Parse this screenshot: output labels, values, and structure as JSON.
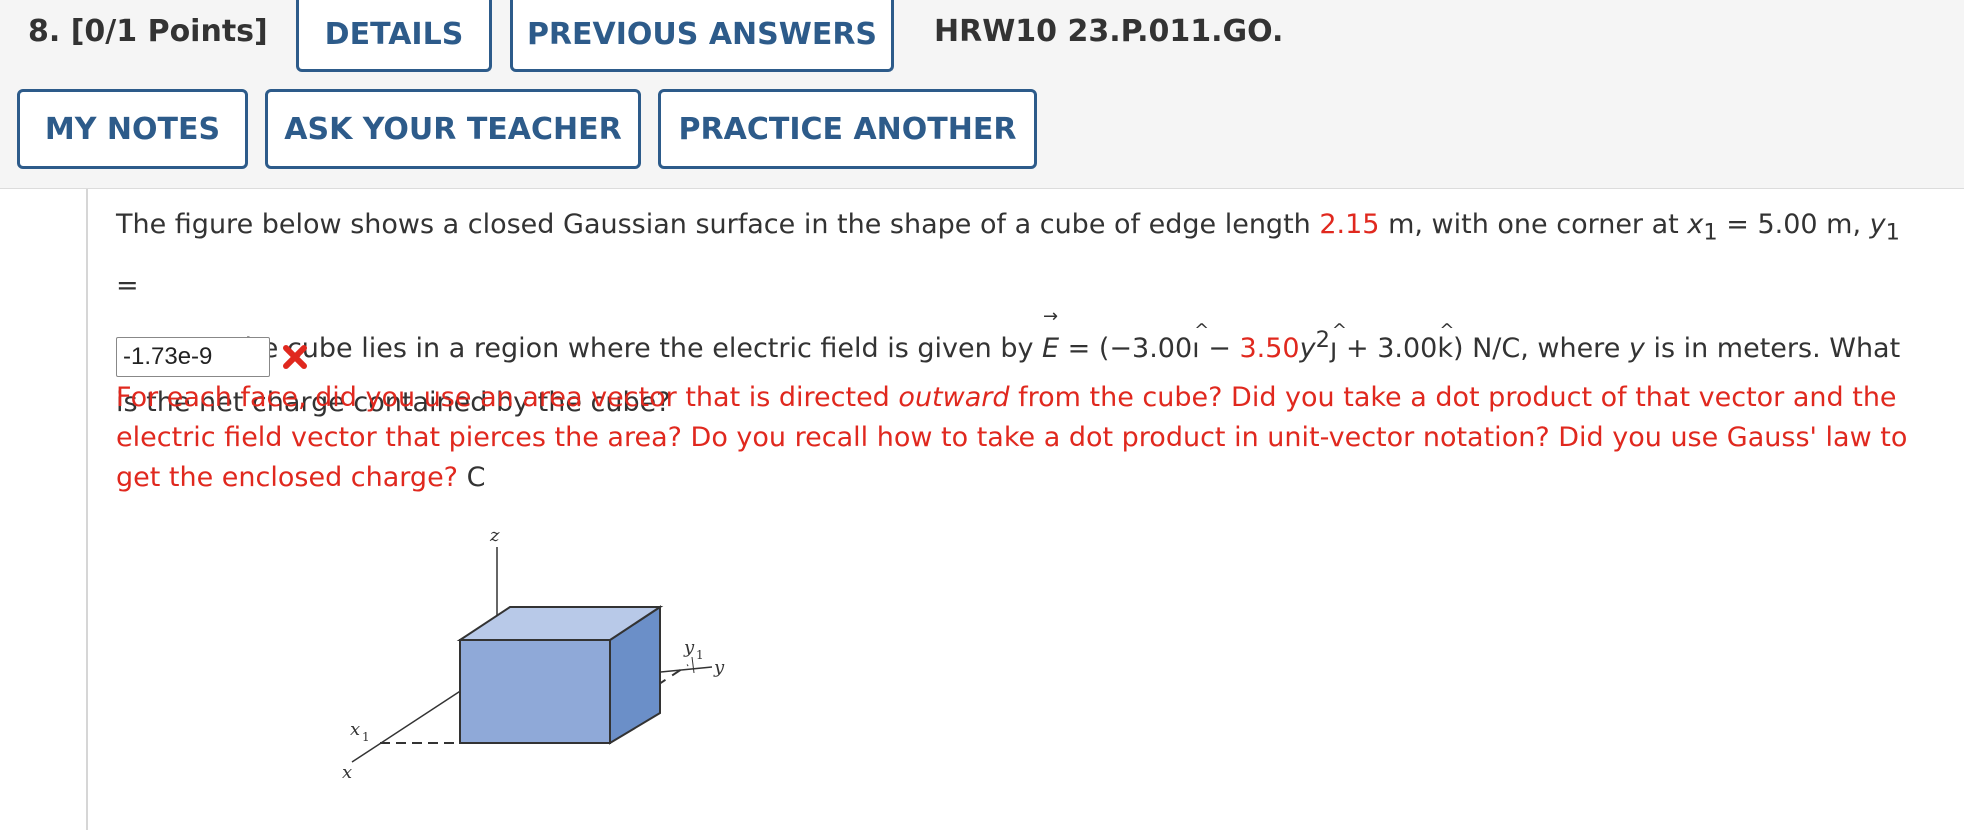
{
  "header": {
    "question_label": "8.  [0/1 Points]",
    "details_label": "DETAILS",
    "previous_answers_label": "PREVIOUS ANSWERS",
    "problem_code": "HRW10 23.P.011.GO.",
    "my_notes_label": "MY NOTES",
    "ask_teacher_label": "ASK YOUR TEACHER",
    "practice_label": "PRACTICE ANOTHER"
  },
  "question": {
    "t1": "The figure below shows a closed Gaussian surface in the shape of a cube of edge length ",
    "edge_length": "2.15",
    "t2": " m, with one corner at ",
    "x_var": "x",
    "sub1": "1",
    "t3": " = 5.00 m, ",
    "y_var": "y",
    "sub2": "1",
    "t4": " =",
    "t5": "4.00 m. The cube lies in a region where the electric field is given by ",
    "E_symbol": "E",
    "E_arrow": "→",
    "t6": " = (−3.00",
    "i_hat_letter": "ı",
    "hat_mark": "^",
    "t7": " − ",
    "coef_red": "3.50",
    "y_var2": "y",
    "exp2": "2",
    "j_hat_letter": "ȷ",
    "hat_mark2": "^",
    "t8": " + 3.00",
    "k_hat_letter": "k",
    "hat_mark3": "^",
    "t9": ") N/C, where ",
    "y_var3": "y",
    "t10": " is in meters. What is the net charge contained by the cube?"
  },
  "answer": {
    "value": "-1.73e-9",
    "status": "incorrect"
  },
  "feedback": {
    "f1": "For each face, did you use an area vector that is directed ",
    "f_em": "outward",
    "f2": " from the cube? Did you take a dot product of that vector and the electric field vector that pierces the area? Do you recall how to take a dot product in unit-vector notation? Did you use Gauss' law to get the enclosed charge? ",
    "unit": "C"
  },
  "figure": {
    "z_label": "z",
    "y1_label": "y",
    "y1_sub": "1",
    "y_label": "y",
    "x1_label": "x",
    "x1_sub": "1",
    "x_label": "x"
  },
  "colors": {
    "accent_blue": "#2d5b8a",
    "error_red": "#e0281e",
    "cube_front": "#8fa9d8",
    "cube_side": "#6b8fc8",
    "cube_top": "#b8c9e8"
  }
}
